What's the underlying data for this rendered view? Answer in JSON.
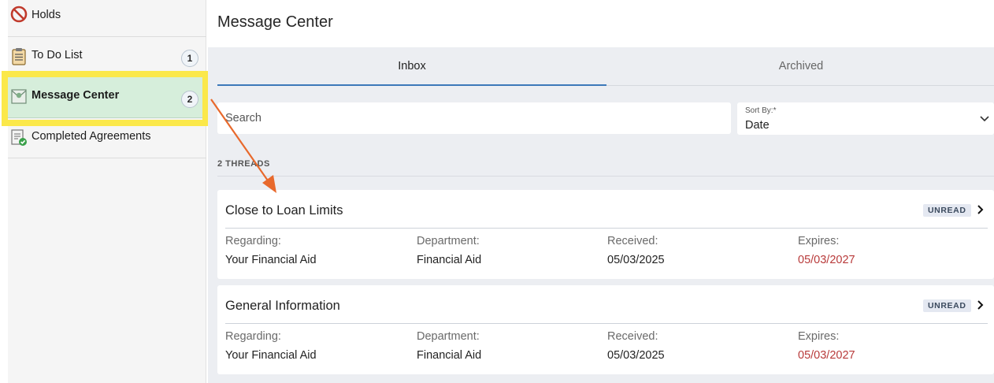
{
  "sidebar": {
    "items": [
      {
        "label": "Holds",
        "icon": "no-entry-icon"
      },
      {
        "label": "To Do List",
        "icon": "clipboard-icon",
        "count": "1"
      },
      {
        "label": "Message Center",
        "icon": "envelope-icon",
        "count": "2",
        "selected": true
      },
      {
        "label": "Completed Agreements",
        "icon": "document-check-icon"
      }
    ]
  },
  "main": {
    "title": "Message Center",
    "tabs": [
      {
        "label": "Inbox",
        "active": true
      },
      {
        "label": "Archived",
        "active": false
      }
    ],
    "search": {
      "placeholder": "Search",
      "value": ""
    },
    "sort": {
      "label": "Sort By:*",
      "value": "Date"
    },
    "thread_count": "2 THREADS",
    "field_labels": {
      "regarding": "Regarding:",
      "department": "Department:",
      "received": "Received:",
      "expires": "Expires:"
    },
    "threads": [
      {
        "title": "Close to Loan Limits",
        "status": "UNREAD",
        "regarding": "Your Financial Aid",
        "department": "Financial Aid",
        "received": "05/03/2025",
        "expires": "05/03/2027"
      },
      {
        "title": "General Information",
        "status": "UNREAD",
        "regarding": "Your Financial Aid",
        "department": "Financial Aid",
        "received": "05/03/2025",
        "expires": "05/03/2027"
      }
    ]
  },
  "colors": {
    "selected_item_bg": "#d6eedb",
    "highlight": "#fbe84a",
    "annotation_arrow": "#e8692c",
    "active_tab_underline": "#3c78b9",
    "expires_text": "#b83a3a"
  }
}
